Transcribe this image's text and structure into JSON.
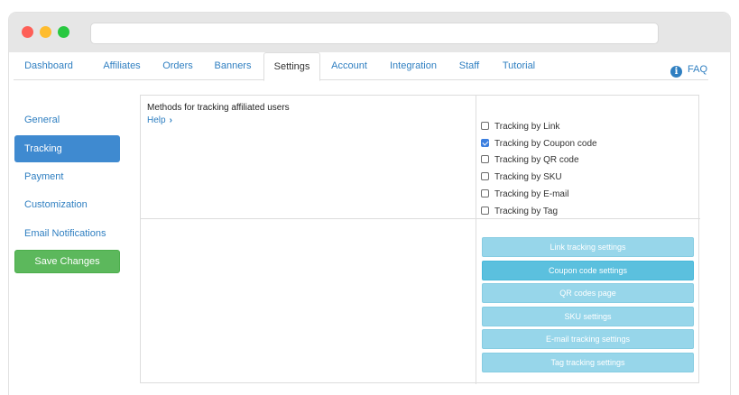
{
  "tabs": [
    {
      "label": "Dashboard",
      "active": false
    },
    {
      "label": "Affiliates",
      "active": false
    },
    {
      "label": "Orders",
      "active": false
    },
    {
      "label": "Banners",
      "active": false
    },
    {
      "label": "Settings",
      "active": true
    },
    {
      "label": "Account",
      "active": false
    },
    {
      "label": "Integration",
      "active": false
    },
    {
      "label": "Staff",
      "active": false
    },
    {
      "label": "Tutorial",
      "active": false
    }
  ],
  "faq": {
    "label": "FAQ",
    "icon": "info-circle-icon"
  },
  "sidebar": {
    "items": [
      {
        "label": "General",
        "active": false
      },
      {
        "label": "Tracking",
        "active": true
      },
      {
        "label": "Payment",
        "active": false
      },
      {
        "label": "Customization",
        "active": false
      },
      {
        "label": "Email Notifications",
        "active": false
      }
    ],
    "save_label": "Save Changes"
  },
  "methods": {
    "heading": "Methods for tracking affiliated users",
    "help_label": "Help",
    "options": [
      {
        "label": "Tracking by Link",
        "checked": false
      },
      {
        "label": "Tracking by Coupon code",
        "checked": true
      },
      {
        "label": "Tracking by QR code",
        "checked": false
      },
      {
        "label": "Tracking by SKU",
        "checked": false
      },
      {
        "label": "Tracking by E-mail",
        "checked": false
      },
      {
        "label": "Tracking by Tag",
        "checked": false
      }
    ]
  },
  "settings_buttons": [
    {
      "label": "Link tracking settings",
      "active": false
    },
    {
      "label": "Coupon code settings",
      "active": true
    },
    {
      "label": "QR codes page",
      "active": false
    },
    {
      "label": "SKU settings",
      "active": false
    },
    {
      "label": "E-mail tracking settings",
      "active": false
    },
    {
      "label": "Tag tracking settings",
      "active": false
    }
  ],
  "colors": {
    "link": "#2f7fc1",
    "active_nav": "#3f8ad0",
    "save_button": "#5cb85c",
    "settings_button": "#97d6ea",
    "settings_button_active": "#5bc0de"
  }
}
